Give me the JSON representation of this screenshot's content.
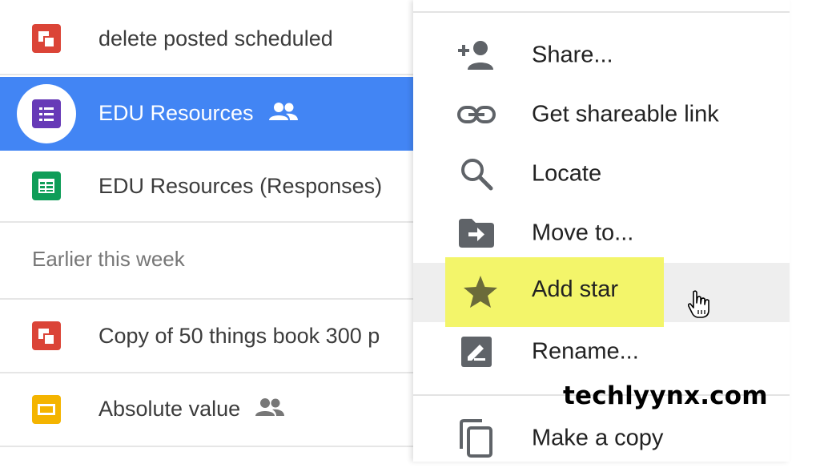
{
  "files": {
    "rows": [
      {
        "name": "delete posted scheduled",
        "type": "slides-red",
        "shared": false
      },
      {
        "name": "EDU Resources",
        "type": "forms",
        "shared": true,
        "selected": true
      },
      {
        "name": "EDU Resources (Responses)",
        "type": "sheets",
        "shared": false
      }
    ],
    "section_label": "Earlier this week",
    "rows2": [
      {
        "name": "Copy of 50 things book 300 p",
        "type": "slides-red",
        "shared": false
      },
      {
        "name": "Absolute value",
        "type": "slides-yellow",
        "shared": true
      }
    ]
  },
  "menu": {
    "items": [
      {
        "label": "Share...",
        "icon": "person-add-icon"
      },
      {
        "label": "Get shareable link",
        "icon": "link-icon"
      },
      {
        "label": "Locate",
        "icon": "search-icon"
      },
      {
        "label": "Move to...",
        "icon": "move-to-folder-icon"
      },
      {
        "label": "Add star",
        "icon": "star-icon",
        "hovered": true
      },
      {
        "label": "Rename...",
        "icon": "rename-icon"
      },
      {
        "label": "Make a copy",
        "icon": "copy-icon"
      }
    ]
  },
  "watermark": "techlyynx.com",
  "colors": {
    "selected_row": "#4285f4",
    "highlight": "#f3f56a",
    "slides_red": "#db4437",
    "forms_purple": "#673ab7",
    "sheets_green": "#0f9d58",
    "slides_yellow": "#f4b400"
  }
}
